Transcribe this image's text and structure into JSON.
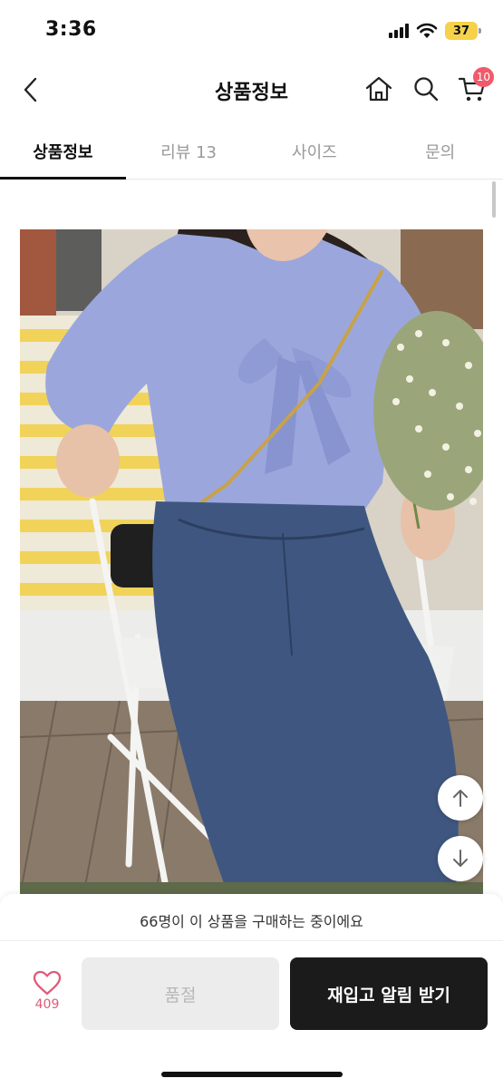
{
  "status_bar": {
    "time": "3:36",
    "battery": "37"
  },
  "header": {
    "title": "상품정보",
    "cart_count": "10"
  },
  "tabs": [
    {
      "label": "상품정보"
    },
    {
      "label": "리뷰 13"
    },
    {
      "label": "사이즈"
    },
    {
      "label": "문의"
    }
  ],
  "icons": [
    "back-icon",
    "home-icon",
    "search-icon",
    "cart-icon",
    "wifi-icon",
    "signal-icon",
    "battery-icon",
    "arrow-up-icon",
    "arrow-down-icon",
    "heart-icon"
  ],
  "bottom": {
    "notice": "66명이 이 상품을 구매하는 중이에요",
    "like_count": "409",
    "soldout_label": "품절",
    "restock_label": "재입고 알림 받기"
  },
  "colors": {
    "accent_badge": "#f05a6a",
    "heart": "#e05a7a",
    "primary_button": "#1b1b1b",
    "disabled_button": "#ececec"
  }
}
